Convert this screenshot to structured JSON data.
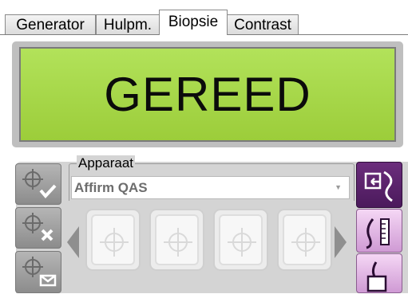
{
  "tabs": [
    {
      "label": "Generator",
      "active": false
    },
    {
      "label": "Hulpm.",
      "active": false
    },
    {
      "label": "Biopsie",
      "active": true
    },
    {
      "label": "Contrast",
      "active": false
    }
  ],
  "status": {
    "text": "GEREED",
    "color": "#a6d84a"
  },
  "device": {
    "group_label": "Apparaat",
    "selected": "Affirm QAS"
  },
  "left_buttons": [
    {
      "icon": "target-check-icon"
    },
    {
      "icon": "target-delete-icon"
    },
    {
      "icon": "target-message-icon"
    }
  ],
  "slots": [
    {
      "icon": "crosshair-icon"
    },
    {
      "icon": "crosshair-icon"
    },
    {
      "icon": "crosshair-icon"
    },
    {
      "icon": "crosshair-icon"
    }
  ],
  "right_buttons": [
    {
      "icon": "biopsy-target-arrow-icon",
      "active": true
    },
    {
      "icon": "needle-ruler-icon",
      "active": false
    },
    {
      "icon": "needle-guide-icon",
      "active": false
    }
  ],
  "colors": {
    "accent_purple": "#5a2369",
    "light_purple": "#e6b8e8"
  }
}
